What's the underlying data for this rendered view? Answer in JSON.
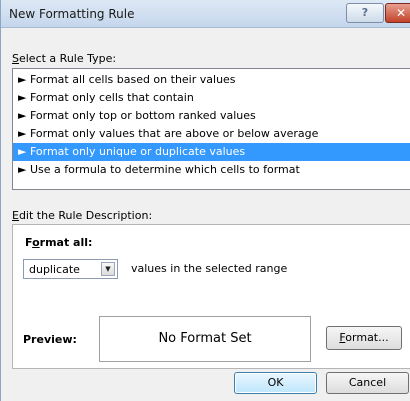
{
  "window": {
    "title": "New Formatting Rule",
    "help_label": "?",
    "close_label": "✕"
  },
  "rule_type": {
    "label_accel": "S",
    "label_rest": "elect a Rule Type:",
    "arrow": "►",
    "items": [
      "Format all cells based on their values",
      "Format only cells that contain",
      "Format only top or bottom ranked values",
      "Format only values that are above or below average",
      "Format only unique or duplicate values",
      "Use a formula to determine which cells to format"
    ],
    "selected": "Format only unique or duplicate values"
  },
  "description": {
    "label_accel": "E",
    "label_rest": "dit the Rule Description:",
    "format_all_pre": "F",
    "format_all_accel": "o",
    "format_all_rest": "rmat all:",
    "dropdown_value": "duplicate",
    "dropdown_arrow": "▼",
    "range_text": "values in the selected range"
  },
  "preview": {
    "label": "Preview:",
    "text": "No Format Set",
    "format_accel": "F",
    "format_rest": "ormat..."
  },
  "buttons": {
    "ok": "OK",
    "cancel": "Cancel"
  }
}
